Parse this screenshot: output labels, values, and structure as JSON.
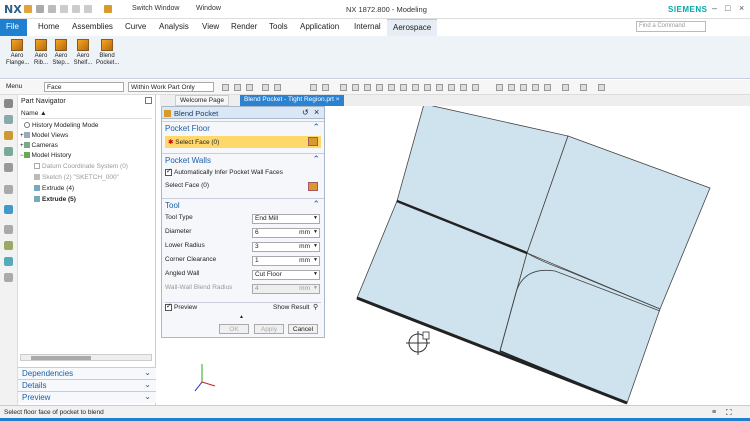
{
  "titlebar": {
    "logo": "NX",
    "switch_window": "Switch Window",
    "window_menu": "Window",
    "app_title": "NX 1872.800 - Modeling",
    "brand": "SIEMENS"
  },
  "ribbon_tabs": [
    "File",
    "Home",
    "Assemblies",
    "Curve",
    "Analysis",
    "View",
    "Render",
    "Tools",
    "Application",
    "Internal",
    "Aerospace"
  ],
  "find_command_placeholder": "Find a Command",
  "ribbon_buttons": [
    {
      "label": "Aero Flange..."
    },
    {
      "label": "Aero Rib..."
    },
    {
      "label": "Aero Step..."
    },
    {
      "label": "Aero Shelf..."
    },
    {
      "label": "Blend Pocket..."
    }
  ],
  "toolbar": {
    "menu": "Menu",
    "filter": "Face",
    "scope": "Within Work Part Only"
  },
  "part_navigator": {
    "title": "Part Navigator",
    "col_name": "Name",
    "items": [
      "History Modeling Mode",
      "Model Views",
      "Cameras",
      "Model History",
      "Datum Coordinate System (0)",
      "Sketch (2) \"SKETCH_000\"",
      "Extrude (4)",
      "Extrude (5)"
    ]
  },
  "sections": [
    "Dependencies",
    "Details",
    "Preview"
  ],
  "doc_tabs": [
    "Welcome Page",
    "Blend Pocket - Tight Region.prt"
  ],
  "dialog": {
    "title": "Blend Pocket",
    "pocket_floor": {
      "header": "Pocket Floor",
      "select": "Select Face (0)"
    },
    "pocket_walls": {
      "header": "Pocket Walls",
      "auto_infer": "Automatically Infer Pocket Wall Faces",
      "select": "Select Face (0)"
    },
    "tool": {
      "header": "Tool",
      "rows": [
        {
          "label": "Tool Type",
          "value": "End Mill",
          "unit": ""
        },
        {
          "label": "Diameter",
          "value": "6",
          "unit": "mm"
        },
        {
          "label": "Lower Radius",
          "value": "3",
          "unit": "mm"
        },
        {
          "label": "Corner Clearance",
          "value": "1",
          "unit": "mm"
        },
        {
          "label": "Angled Wall",
          "value": "Cut Floor",
          "unit": ""
        },
        {
          "label": "Wall-Wall Blend Radius",
          "value": "4",
          "unit": "mm"
        }
      ]
    },
    "preview": "Preview",
    "show_result": "Show Result",
    "ok": "OK",
    "apply": "Apply",
    "cancel": "Cancel"
  },
  "status": "Select floor face of pocket to blend",
  "colors": {
    "accent": "#1f7fd1",
    "face": "#cfe3ee",
    "highlight": "#ffd86b"
  }
}
